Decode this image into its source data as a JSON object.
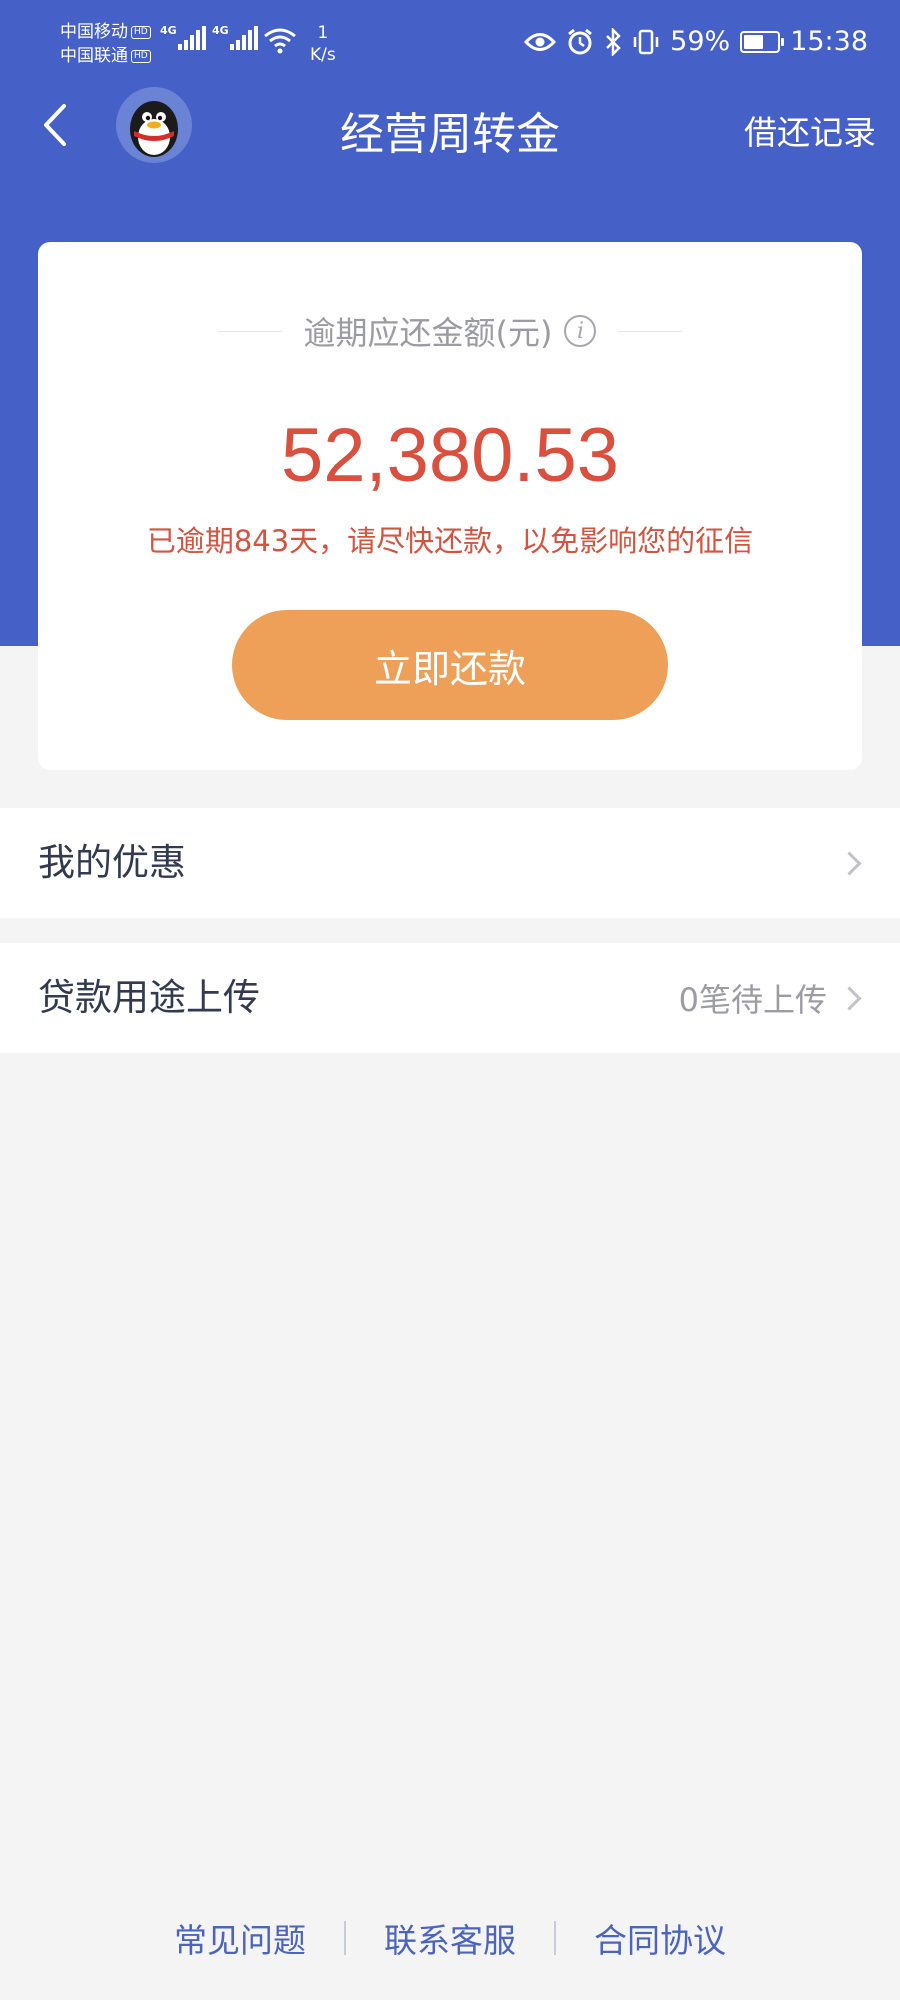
{
  "status_bar": {
    "carrier_1": "中国移动",
    "carrier_2": "中国联通",
    "hd_badge": "HD",
    "network_1": "4G",
    "network_2": "4G",
    "speed_value": "1",
    "speed_unit": "K/s",
    "battery_percent": "59%",
    "battery_level": 0.59,
    "time": "15:38"
  },
  "header": {
    "title": "经营周转金",
    "records_link": "借还记录"
  },
  "card": {
    "amount_label": "逾期应还金额(元)",
    "amount": "52,380.53",
    "overdue_message": "已逾期843天，请尽快还款，以免影响您的征信",
    "repay_button": "立即还款"
  },
  "rows": [
    {
      "label": "我的优惠",
      "value": ""
    },
    {
      "label": "贷款用途上传",
      "value": "0笔待上传"
    }
  ],
  "footer": {
    "links": [
      "常见问题",
      "联系客服",
      "合同协议"
    ]
  },
  "colors": {
    "header_blue": "#4560c6",
    "amount_red": "#d9503e",
    "button_orange": "#eea059",
    "link_blue": "#4a64c0"
  }
}
